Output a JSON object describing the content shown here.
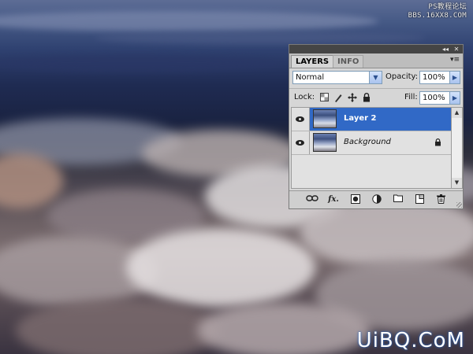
{
  "watermark": {
    "line1": "PS教程论坛",
    "line2": "BBS.16XX8.COM",
    "bottom": "UiBQ.CoM"
  },
  "panel": {
    "titlebar": {
      "collapse_glyph": "◂◂",
      "close_glyph": "✕"
    },
    "tabs": [
      {
        "label": "LAYERS",
        "active": true
      },
      {
        "label": "INFO",
        "active": false
      }
    ],
    "menu_glyph": "▾≡",
    "blend_mode": "Normal",
    "opacity_label": "Opacity:",
    "opacity_value": "100%",
    "lock_label": "Lock:",
    "fill_label": "Fill:",
    "fill_value": "100%",
    "layers": [
      {
        "name": "Layer 2",
        "selected": true,
        "visible": true,
        "locked": false
      },
      {
        "name": "Background",
        "selected": false,
        "visible": true,
        "locked": true
      }
    ],
    "footer_icons": [
      "link-layers-icon",
      "fx-icon",
      "layer-mask-icon",
      "adjustment-layer-icon",
      "group-folder-icon",
      "new-layer-icon",
      "trash-icon"
    ],
    "footer_fx_text": "fx."
  },
  "colors": {
    "selection": "#3169c6",
    "panel_bg": "#d6d6d6",
    "watermark_glow": "#2a66c0"
  }
}
